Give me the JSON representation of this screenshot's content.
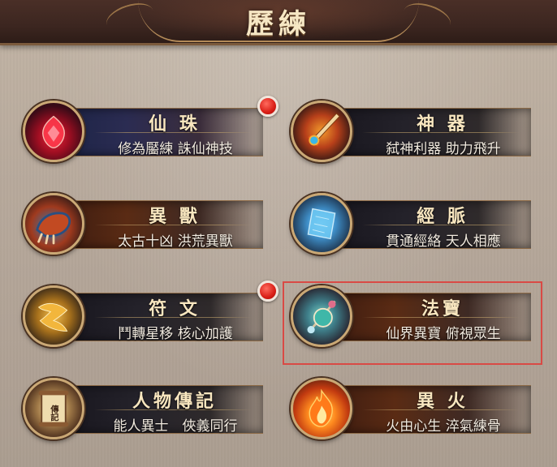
{
  "header": {
    "title": "歷練"
  },
  "cards": [
    {
      "title": "仙 珠",
      "subtitle": "修為靨練 誅仙神技",
      "icon": "red-pearl-icon",
      "badge": true
    },
    {
      "title": "神 器",
      "subtitle": "弑神利器 助力飛升",
      "icon": "flaming-sword-icon",
      "badge": false
    },
    {
      "title": "異 獸",
      "subtitle": "太古十凶 洪荒異獸",
      "icon": "beast-claw-icon",
      "badge": false
    },
    {
      "title": "經 脈",
      "subtitle": "貫通經絡 天人相應",
      "icon": "blue-crystal-icon",
      "badge": false
    },
    {
      "title": "符 文",
      "subtitle": "鬥轉星移 核心加護",
      "icon": "golden-rune-icon",
      "badge": true
    },
    {
      "title": "法寶",
      "subtitle": "仙界異寶 俯視眾生",
      "icon": "magic-treasure-icon",
      "badge": false,
      "selected": true
    },
    {
      "title": "人物傳記",
      "subtitle": "能人異士　俠義同行",
      "icon": "biography-scroll-icon",
      "badge": false,
      "icon_text": "傳記"
    },
    {
      "title": "異 火",
      "subtitle": "火由心生 淬氣練骨",
      "icon": "fire-icon",
      "badge": false
    }
  ],
  "colors": {
    "title_gold": "#f8e6bf",
    "badge_red": "#d91e16",
    "selection_outline": "#d94a45"
  }
}
